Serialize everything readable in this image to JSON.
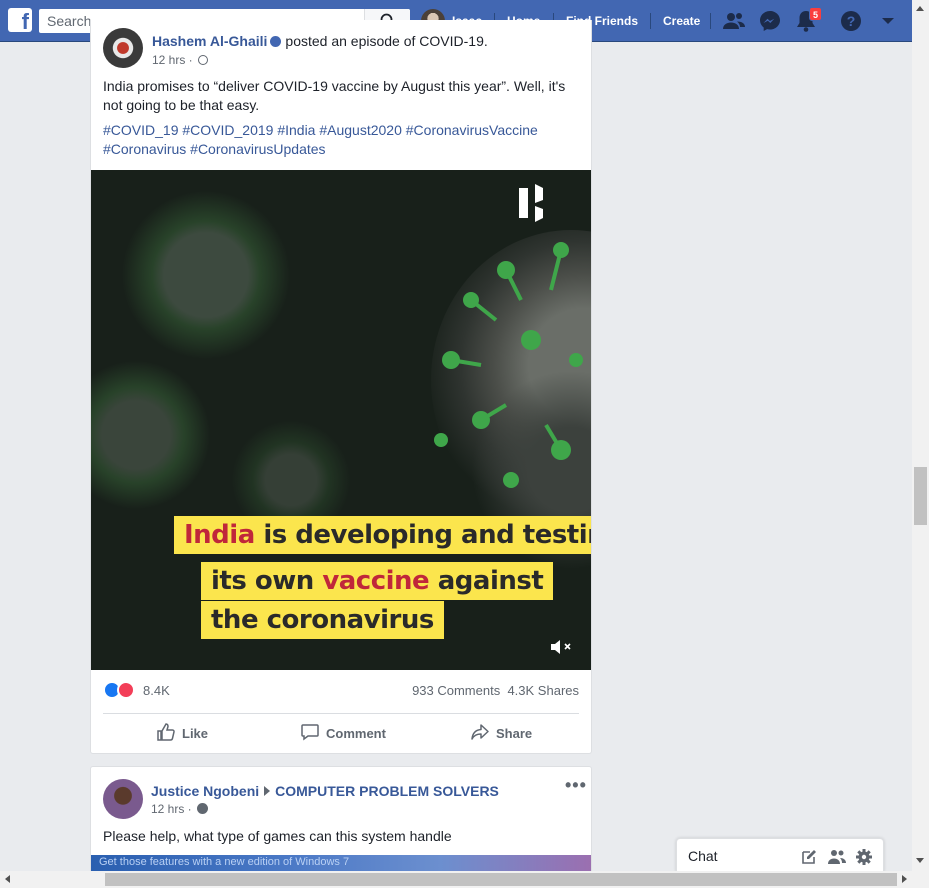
{
  "colors": {
    "brand": "#4267b2",
    "link": "#385898",
    "notification": "#fa3e3e",
    "caption_bg": "#fbe54d",
    "caption_accent": "#c0273a"
  },
  "topbar": {
    "logo_icon": "facebook-logo-icon",
    "search": {
      "placeholder": "Search",
      "value": ""
    },
    "profile_name": "Isaac",
    "nav": {
      "home": "Home",
      "find_friends": "Find Friends",
      "create": "Create"
    },
    "icons": [
      "friend-requests-icon",
      "messenger-icon",
      "notifications-icon",
      "help-icon",
      "account-menu-icon"
    ],
    "notification_count": "5"
  },
  "post1": {
    "author": "Hashem Al-Ghaili",
    "header_suffix": "posted an episode of COVID-19.",
    "time": "12 hrs ·",
    "text": "India promises to “deliver COVID-19 vaccine by August this year”. Well, it's not going to be that easy.",
    "hashtags": "#COVID_19 #COVID_2019 #India #August2020 #CoronavirusVaccine #Coronavirus #CoronavirusUpdates",
    "video": {
      "caption_line1_accent": "India",
      "caption_line1_rest": " is developing and testing",
      "caption_line2_start": "its own ",
      "caption_line2_accent": "vaccine",
      "caption_line2_end": " against",
      "caption_line3": "the coronavirus"
    },
    "reaction_count": "8.4K",
    "comments": "933 Comments",
    "shares": "4.3K Shares",
    "actions": {
      "like": "Like",
      "comment": "Comment",
      "share": "Share"
    }
  },
  "post2": {
    "author": "Justice Ngobeni",
    "group": "COMPUTER PROBLEM SOLVERS",
    "time": "12 hrs ·",
    "more": "•••",
    "text": "Please help, what type of games can this system handle",
    "image_text": "Get those features with a new edition of Windows 7"
  },
  "chat": {
    "label": "Chat"
  }
}
